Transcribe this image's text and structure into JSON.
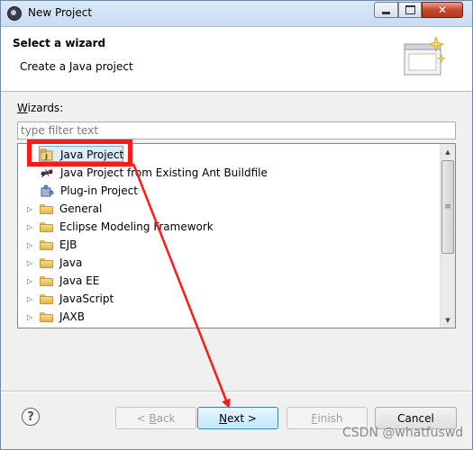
{
  "window": {
    "title": "New Project",
    "close_glyph": "✕"
  },
  "banner": {
    "title": "Select a wizard",
    "description": "Create a Java project"
  },
  "wizards_label_accel": "W",
  "wizards_label_rest": "izards:",
  "filter": {
    "value": "",
    "placeholder": "type filter text"
  },
  "tree": {
    "items": [
      {
        "label": "Java Project",
        "icon": "java-project-icon",
        "expandable": false,
        "selected": true
      },
      {
        "label": "Java Project from Existing Ant Buildfile",
        "icon": "ant-icon",
        "expandable": false
      },
      {
        "label": "Plug-in Project",
        "icon": "plugin-icon",
        "expandable": false
      },
      {
        "label": "General",
        "icon": "folder-icon",
        "expandable": true
      },
      {
        "label": "Eclipse Modeling Framework",
        "icon": "folder-icon",
        "expandable": true
      },
      {
        "label": "EJB",
        "icon": "folder-icon",
        "expandable": true
      },
      {
        "label": "Java",
        "icon": "folder-icon",
        "expandable": true
      },
      {
        "label": "Java EE",
        "icon": "folder-icon",
        "expandable": true
      },
      {
        "label": "JavaScript",
        "icon": "folder-icon",
        "expandable": true
      },
      {
        "label": "JAXB",
        "icon": "folder-icon",
        "expandable": true
      }
    ]
  },
  "buttons": {
    "help": "?",
    "back": "< Back",
    "back_accel": "B",
    "next": "Next >",
    "next_accel": "N",
    "finish": "Finish",
    "finish_accel": "F",
    "cancel": "Cancel"
  },
  "annotation": {
    "color": "#ff1a1a"
  },
  "watermark": "CSDN @whatfuswd"
}
